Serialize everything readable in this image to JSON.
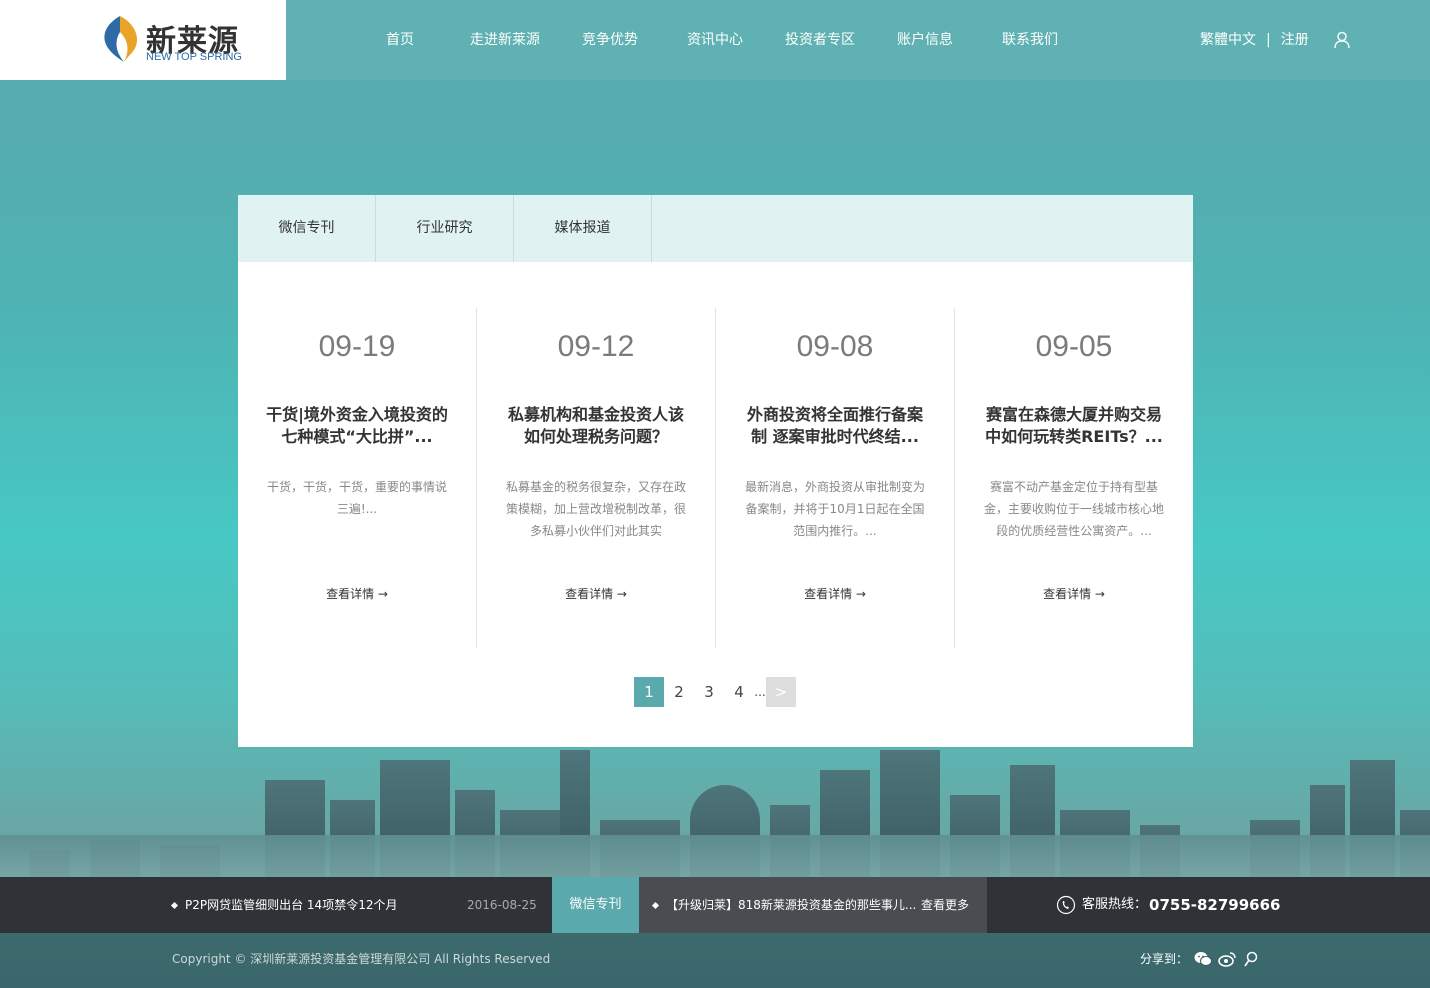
{
  "brand": {
    "name_cn": "新莱源",
    "name_en": "NEW TOP SPRING",
    "accent": "#5aa9ad"
  },
  "nav": [
    "首页",
    "走进新莱源",
    "竞争优势",
    "资讯中心",
    "投资者专区",
    "账户信息",
    "联系我们"
  ],
  "top_right": {
    "lang": "繁體中文",
    "separator": "|",
    "register": "注册",
    "user_icon": "user-icon"
  },
  "tabs": [
    "微信专刊",
    "行业研究",
    "媒体报道"
  ],
  "items": [
    {
      "date": "09-19",
      "title": "干货|境外资金入境投资的七种模式“大比拼”...",
      "desc": "干货，干货，干货，重要的事情说三遍!...",
      "more": "查看详情 →"
    },
    {
      "date": "09-12",
      "title": "私募机构和基金投资人该如何处理税务问题？",
      "desc": "私募基金的税务很复杂，又存在政策模糊，加上营改增税制改革，很多私募小伙伴们对此其实",
      "more": "查看详情 →"
    },
    {
      "date": "09-08",
      "title": "外商投资将全面推行备案制 逐案审批时代终结...",
      "desc": "最新消息，外商投资从审批制变为备案制，并将于10月1日起在全国范围内推行。...",
      "more": "查看详情 →"
    },
    {
      "date": "09-05",
      "title": "赛富在森德大厦并购交易中如何玩转类REITs？...",
      "desc": "赛富不动产基金定位于持有型基金，主要收购位于一线城市核心地段的优质经营性公寓资产。...",
      "more": "查看详情 →"
    }
  ],
  "pager": {
    "pages": [
      "1",
      "2",
      "3",
      "4"
    ],
    "active": "1",
    "dots": "...",
    "next": ">"
  },
  "newsbar": {
    "news1": "P2P网贷监管细则出台 14项禁令12个月",
    "date1": "2016-08-25",
    "category": "微信专刊",
    "news2": "【升级归莱】818新莱源投资基金的那些事儿...",
    "more": "查看更多",
    "hotline_label": "客服热线：",
    "hotline": "0755-82799666"
  },
  "footer": {
    "copyright": "Copyright © 深圳新莱源投资基金管理有限公司 All Rights Reserved",
    "share_label": "分享到：",
    "share_icons": [
      "wechat-icon",
      "weibo-icon",
      "tencent-weibo-icon"
    ]
  }
}
